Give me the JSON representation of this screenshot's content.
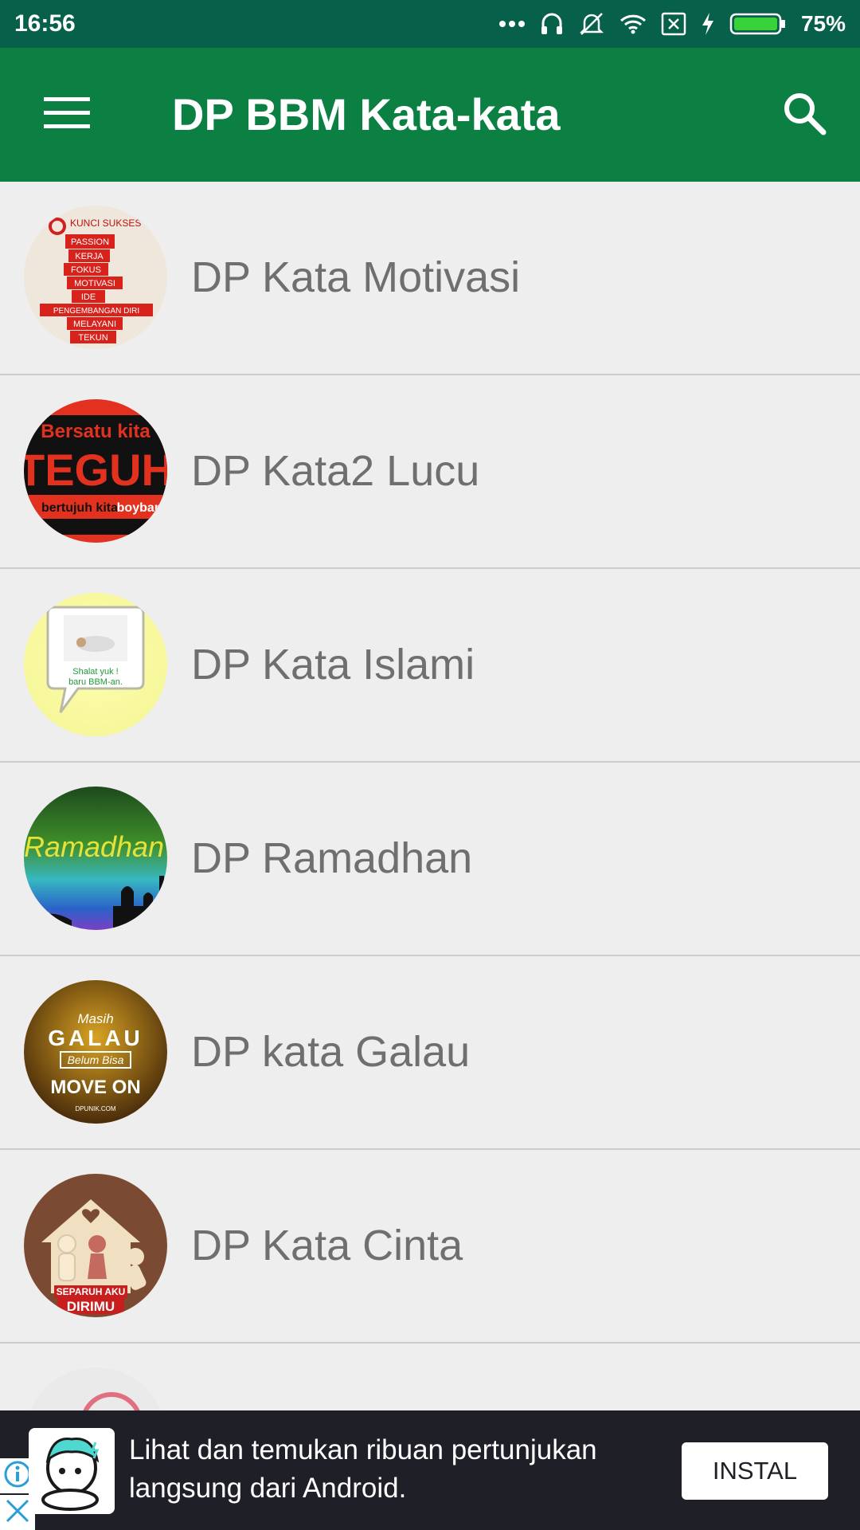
{
  "status_bar": {
    "time": "16:56",
    "battery": "75%",
    "icons": [
      "more-dots-icon",
      "headset-icon",
      "mute-icon",
      "wifi-icon",
      "sim-x-icon",
      "charging-icon",
      "battery-icon"
    ]
  },
  "app_bar": {
    "title": "DP BBM Kata-kata",
    "menu_icon": "hamburger-icon",
    "search_icon": "search-icon",
    "color": "#0c8043"
  },
  "list": {
    "items": [
      {
        "label": "DP Kata Motivasi",
        "thumb_texts": [
          "KUNCI SUKSES",
          "PASSION",
          "KERJA",
          "FOKUS",
          "MOTIVASI",
          "IDE",
          "PENGEMBANGAN DIRI",
          "MELAYANI",
          "TEKUN"
        ]
      },
      {
        "label": "DP Kata2 Lucu",
        "thumb_texts": [
          "Bersatu kita",
          "TEGUH",
          "bertujuh kita",
          "boyband"
        ]
      },
      {
        "label": "DP Kata Islami",
        "thumb_texts": [
          "Shalat yuk !",
          "baru BBM-an."
        ]
      },
      {
        "label": "DP Ramadhan",
        "thumb_texts": [
          "Ramadhan"
        ]
      },
      {
        "label": "DP kata Galau",
        "thumb_texts": [
          "Masih",
          "GALAU",
          "Belum Bisa",
          "MOVE ON",
          "DPUNIK.COM"
        ]
      },
      {
        "label": "DP Kata Cinta",
        "thumb_texts": [
          "SEPARUH AKU",
          "DIRIMU"
        ]
      },
      {
        "label": "",
        "thumb_texts": []
      }
    ]
  },
  "ad": {
    "text": "Lihat dan temukan ribuan pertunjukan langsung dari Android.",
    "button": "INSTAL",
    "info_icon": "info-icon",
    "close_icon": "close-icon",
    "background": "#1f1f27"
  }
}
